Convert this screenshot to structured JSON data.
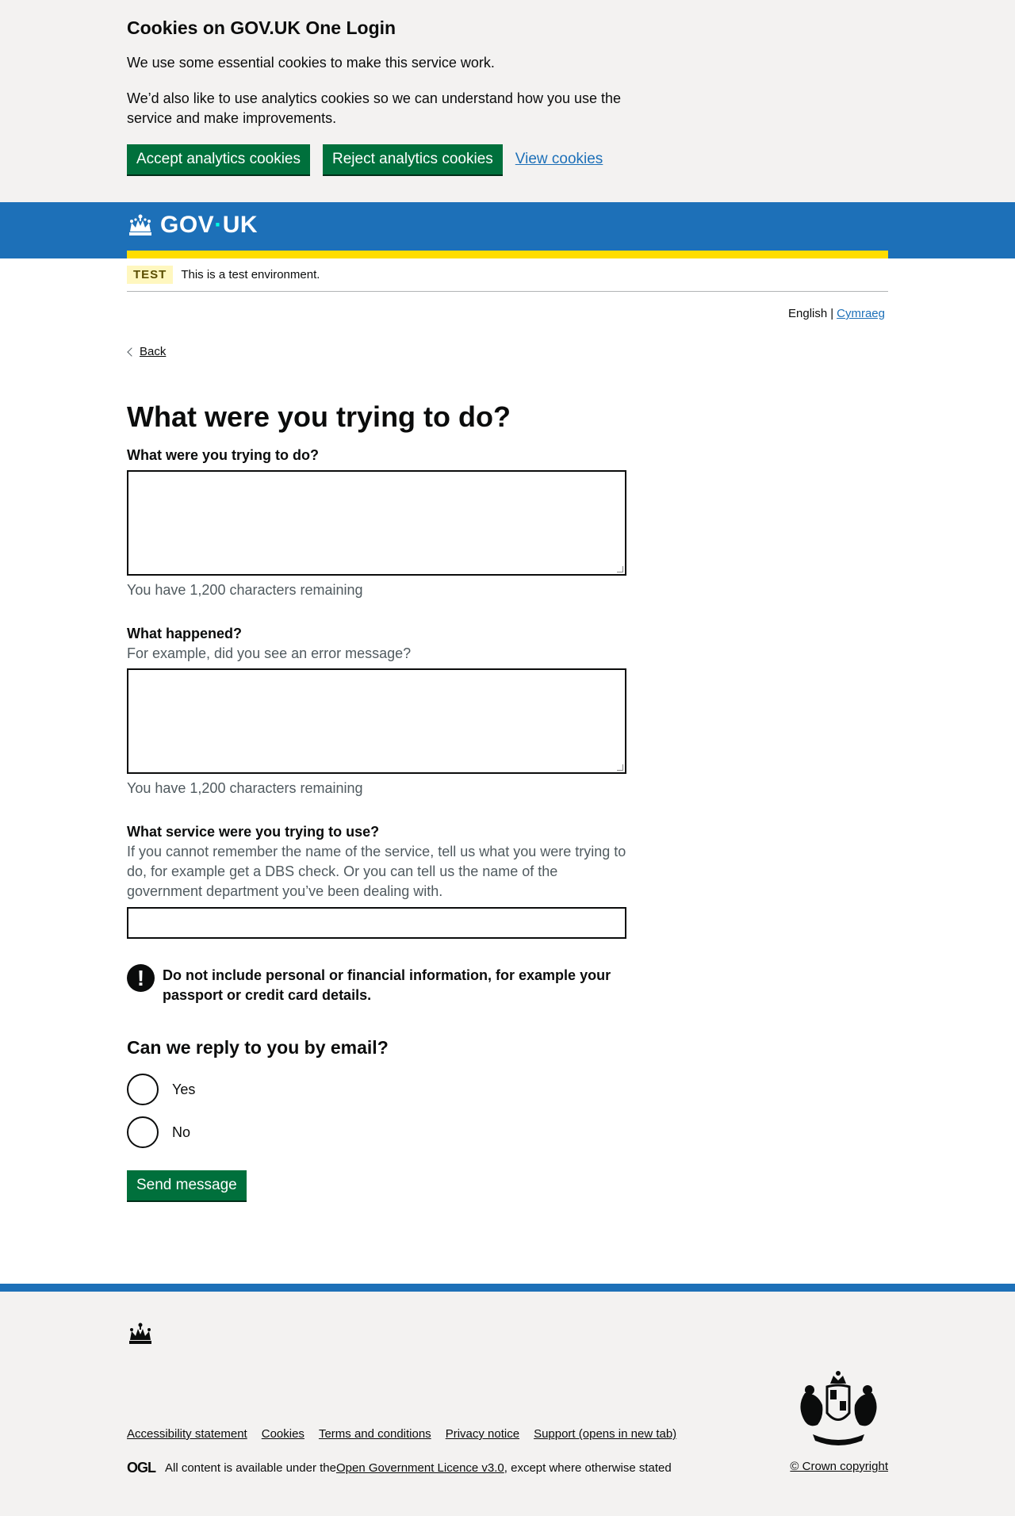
{
  "cookie_banner": {
    "title": "Cookies on GOV.UK One Login",
    "para1": "We use some essential cookies to make this service work.",
    "para2": "We’d also like to use analytics cookies so we can understand how you use the service and make improvements.",
    "accept_label": "Accept analytics cookies",
    "reject_label": "Reject analytics cookies",
    "view_label": "View cookies"
  },
  "header": {
    "logo_gov": "GOV",
    "logo_dot": "·",
    "logo_uk": "UK"
  },
  "phase": {
    "tag": "TEST",
    "text": "This is a test environment."
  },
  "language": {
    "current": "English",
    "separator": "|",
    "other": "Cymraeg"
  },
  "back_label": "Back",
  "page_title": "What were you trying to do?",
  "form": {
    "q1_label": "What were you trying to do?",
    "q1_count": "You have 1,200 characters remaining",
    "q2_label": "What happened?",
    "q2_hint": "For example, did you see an error message?",
    "q2_count": "You have 1,200 characters remaining",
    "q3_label": "What service were you trying to use?",
    "q3_hint": "If you cannot remember the name of the service, tell us what you were trying to do, for example get a DBS check. Or you can tell us the name of the government department you’ve been dealing with.",
    "warning_icon": "!",
    "warning_text": "Do not include personal or financial information, for example your passport or credit card details.",
    "reply_question": "Can we reply to you by email?",
    "radio_yes": "Yes",
    "radio_no": "No",
    "submit_label": "Send message"
  },
  "footer": {
    "links": [
      "Accessibility statement",
      "Cookies",
      "Terms and conditions",
      "Privacy notice",
      "Support (opens in new tab)"
    ],
    "ogl_logo": "OGL",
    "licence_prefix": "All content is available under the ",
    "licence_link": "Open Government Licence v3.0",
    "licence_suffix": ", except where otherwise stated",
    "copyright": "© Crown copyright"
  },
  "colors": {
    "brand_blue": "#1d70b8",
    "button_green": "#00703c",
    "stripe_yellow": "#ffdd00"
  }
}
